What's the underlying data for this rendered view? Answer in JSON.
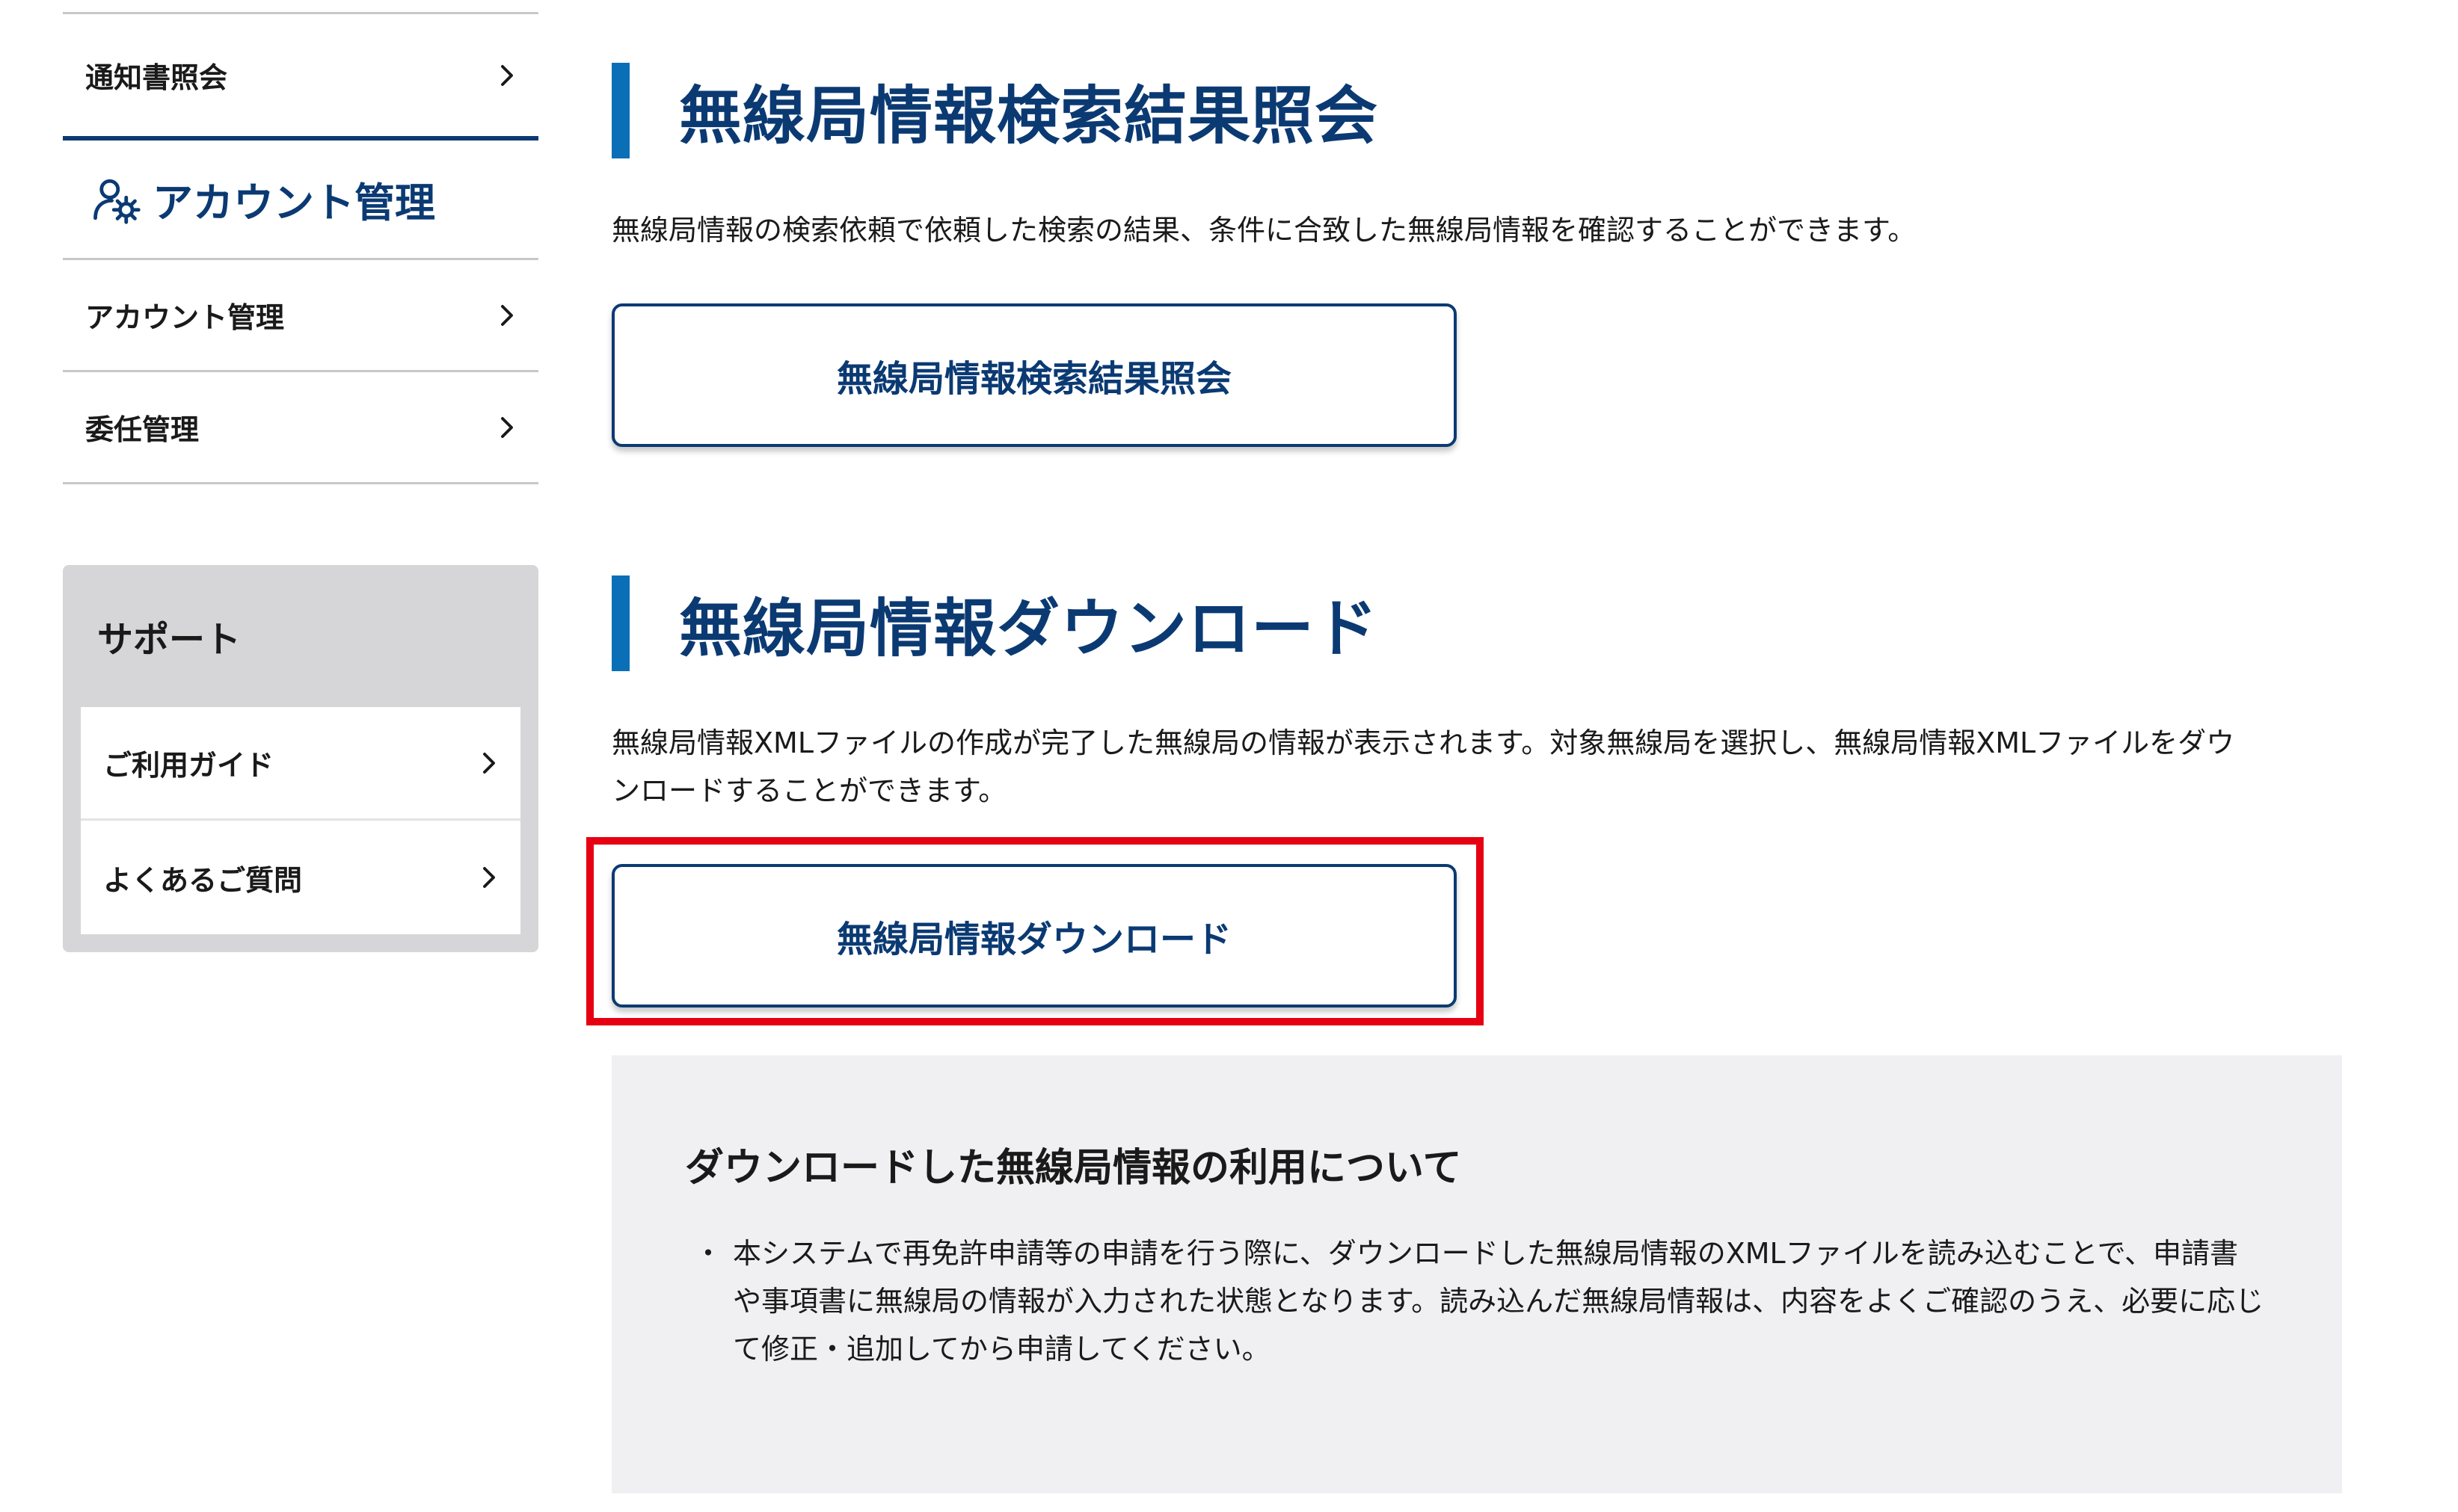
{
  "sidebar": {
    "top_item": {
      "label": "通知書照会"
    },
    "account_section": {
      "title": "アカウント管理",
      "icon": "user-gear-icon"
    },
    "account_items": [
      {
        "label": "アカウント管理"
      },
      {
        "label": "委任管理"
      }
    ],
    "support": {
      "title": "サポート",
      "items": [
        {
          "label": "ご利用ガイド"
        },
        {
          "label": "よくあるご質問"
        }
      ]
    }
  },
  "main": {
    "search_section": {
      "heading": "無線局情報検索結果照会",
      "description": "無線局情報の検索依頼で依頼した検索の結果、条件に合致した無線局情報を確認することができます。",
      "button_label": "無線局情報検索結果照会"
    },
    "download_section": {
      "heading": "無線局情報ダウンロード",
      "description_line1": "無線局情報XMLファイルの作成が完了した無線局の情報が表示されます。対象無線局を選択し、無線局情報XMLファイルをダウ",
      "description_line2": "ンロードすることができます。",
      "button_label": "無線局情報ダウンロード"
    },
    "notice": {
      "title": "ダウンロードした無線局情報の利用について",
      "bullet": "・",
      "text": "本システムで再免許申請等の申請を行う際に、ダウンロードした無線局情報のXMLファイルを読み込むことで、申請書や事項書に無線局の情報が入力された状態となります。読み込んだ無線局情報は、内容をよくご確認のうえ、必要に応じて修正・追加してから申請してください。"
    }
  },
  "colors": {
    "brand_navy": "#0b3a73",
    "accent_blue": "#0b6fb8",
    "highlight_red": "#e60012",
    "support_bg": "#d6d6d8",
    "notice_bg": "#f0f0f2"
  }
}
